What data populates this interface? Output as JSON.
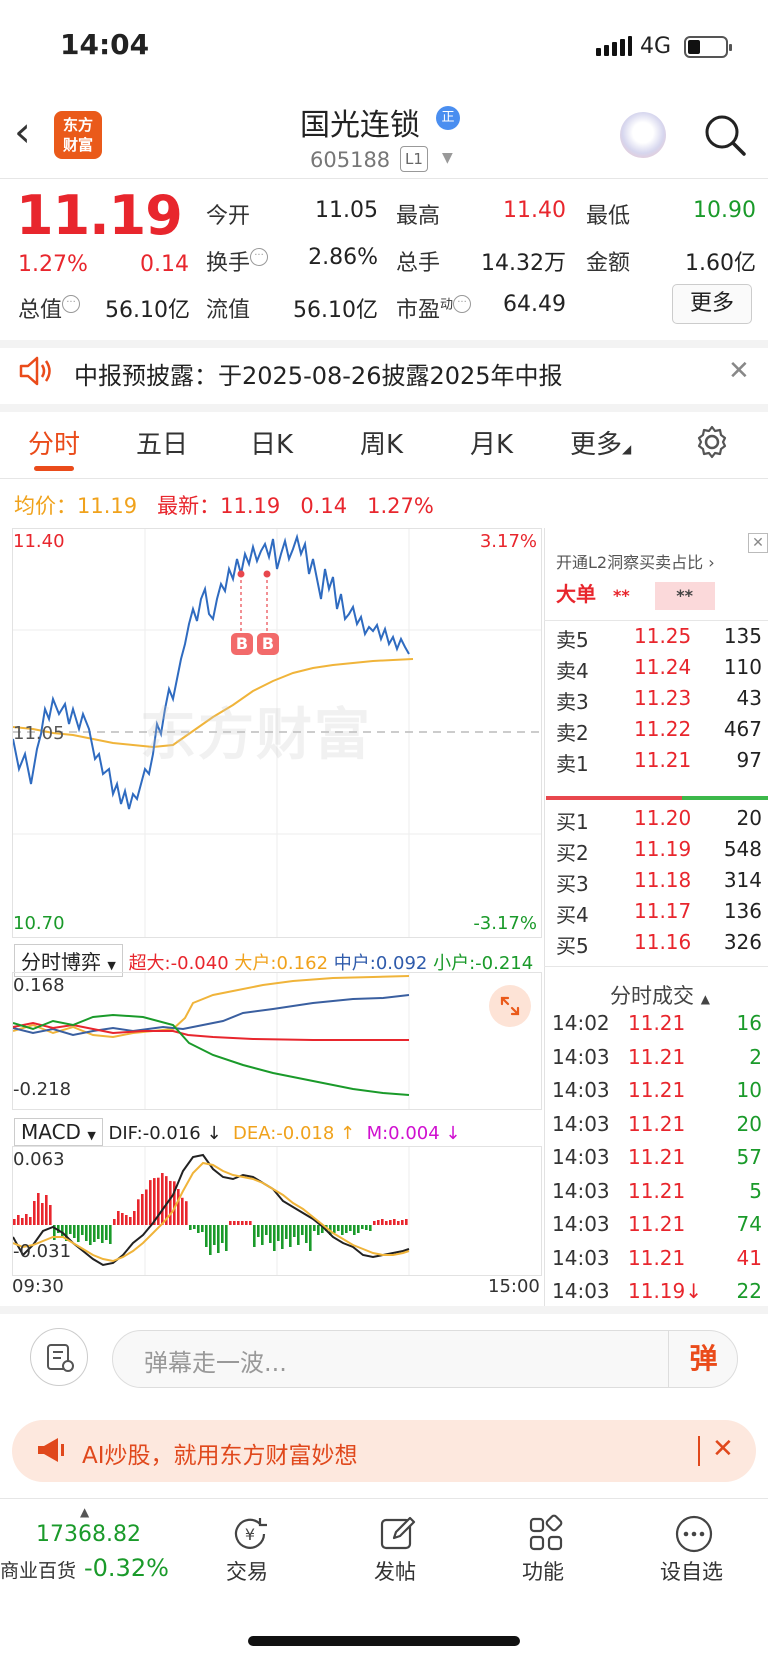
{
  "status": {
    "time": "14:04",
    "network": "4G"
  },
  "header": {
    "logo_text_1": "东方",
    "logo_text_2": "财富",
    "stock_name": "国光连锁",
    "badge": "正",
    "stock_code": "605188",
    "level": "L1"
  },
  "quote": {
    "last_price": "11.19",
    "change_pct": "1.27%",
    "change_amt": "0.14",
    "open_label": "今开",
    "open": "11.05",
    "high_label": "最高",
    "high": "11.40",
    "low_label": "最低",
    "low": "10.90",
    "turnover_label": "换手",
    "turnover": "2.86%",
    "volume_label": "总手",
    "volume": "14.32万",
    "amount_label": "金额",
    "amount": "1.60亿",
    "total_cap_label": "总值",
    "total_cap": "56.10亿",
    "float_cap_label": "流值",
    "float_cap": "56.10亿",
    "pe_label": "市盈",
    "pe_sup": "动",
    "pe": "64.49",
    "more_label": "更多"
  },
  "notice": {
    "text": "中报预披露：于2025-08-26披露2025年中报"
  },
  "tabs": {
    "intraday": "分时",
    "five_day": "五日",
    "daily": "日K",
    "weekly": "周K",
    "monthly": "月K",
    "more": "更多"
  },
  "summary": {
    "avg_label": "均价：",
    "avg": "11.19",
    "latest_label": "最新：",
    "latest": "11.19",
    "latest_chg": "0.14",
    "latest_pct": "1.27%"
  },
  "price_chart": {
    "y_top": "11.40",
    "y_mid": "11.05",
    "y_bottom": "10.70",
    "pct_top": "3.17%",
    "pct_bottom": "-3.17%",
    "watermark": "东方财富",
    "marker": "B"
  },
  "flow": {
    "selector": "分时博弈",
    "super_label": "超大:",
    "super_val": "-0.040",
    "large_label": "大户:",
    "large_val": "0.162",
    "mid_label": "中户:",
    "mid_val": "0.092",
    "small_label": "小户:",
    "small_val": "-0.214",
    "y_top": "0.168",
    "y_bottom": "-0.218"
  },
  "macd": {
    "selector": "MACD",
    "dif": "DIF:-0.016 ↓",
    "dea": "DEA:-0.018 ↑",
    "m": "M:0.004 ↓",
    "y_top": "0.063",
    "y_bottom": "-0.031",
    "x_start": "09:30",
    "x_end": "15:00"
  },
  "order_book": {
    "l2_tip": "开通L2洞察买卖占比",
    "big_order_label": "大单",
    "big_order_masked": "**",
    "big_order_masked2": "**",
    "asks": [
      {
        "label": "卖5",
        "price": "11.25",
        "vol": "135"
      },
      {
        "label": "卖4",
        "price": "11.24",
        "vol": "110"
      },
      {
        "label": "卖3",
        "price": "11.23",
        "vol": "43"
      },
      {
        "label": "卖2",
        "price": "11.22",
        "vol": "467"
      },
      {
        "label": "卖1",
        "price": "11.21",
        "vol": "97"
      }
    ],
    "bids": [
      {
        "label": "买1",
        "price": "11.20",
        "vol": "20"
      },
      {
        "label": "买2",
        "price": "11.19",
        "vol": "548"
      },
      {
        "label": "买3",
        "price": "11.18",
        "vol": "314"
      },
      {
        "label": "买4",
        "price": "11.17",
        "vol": "136"
      },
      {
        "label": "买5",
        "price": "11.16",
        "vol": "326"
      }
    ]
  },
  "trades": {
    "title": "分时成交",
    "rows": [
      {
        "time": "14:02",
        "price": "11.21",
        "vol": "16"
      },
      {
        "time": "14:03",
        "price": "11.21",
        "vol": "2"
      },
      {
        "time": "14:03",
        "price": "11.21",
        "vol": "10"
      },
      {
        "time": "14:03",
        "price": "11.21",
        "vol": "20"
      },
      {
        "time": "14:03",
        "price": "11.21",
        "vol": "57"
      },
      {
        "time": "14:03",
        "price": "11.21",
        "vol": "5"
      },
      {
        "time": "14:03",
        "price": "11.21",
        "vol": "74"
      },
      {
        "time": "14:03",
        "price": "11.21",
        "vol": "41"
      },
      {
        "time": "14:03",
        "price": "11.19↓",
        "vol": "22"
      }
    ]
  },
  "comment": {
    "placeholder": "弹幕走一波...",
    "danmu_btn": "弹"
  },
  "ai_banner": {
    "text": "AI炒股，就用东方财富妙想"
  },
  "bottom_nav": {
    "index_value": "17368.82",
    "index_name": "商业百货",
    "index_change": "-0.32%",
    "trade": "交易",
    "post": "发帖",
    "function": "功能",
    "watchlist": "设自选"
  }
}
